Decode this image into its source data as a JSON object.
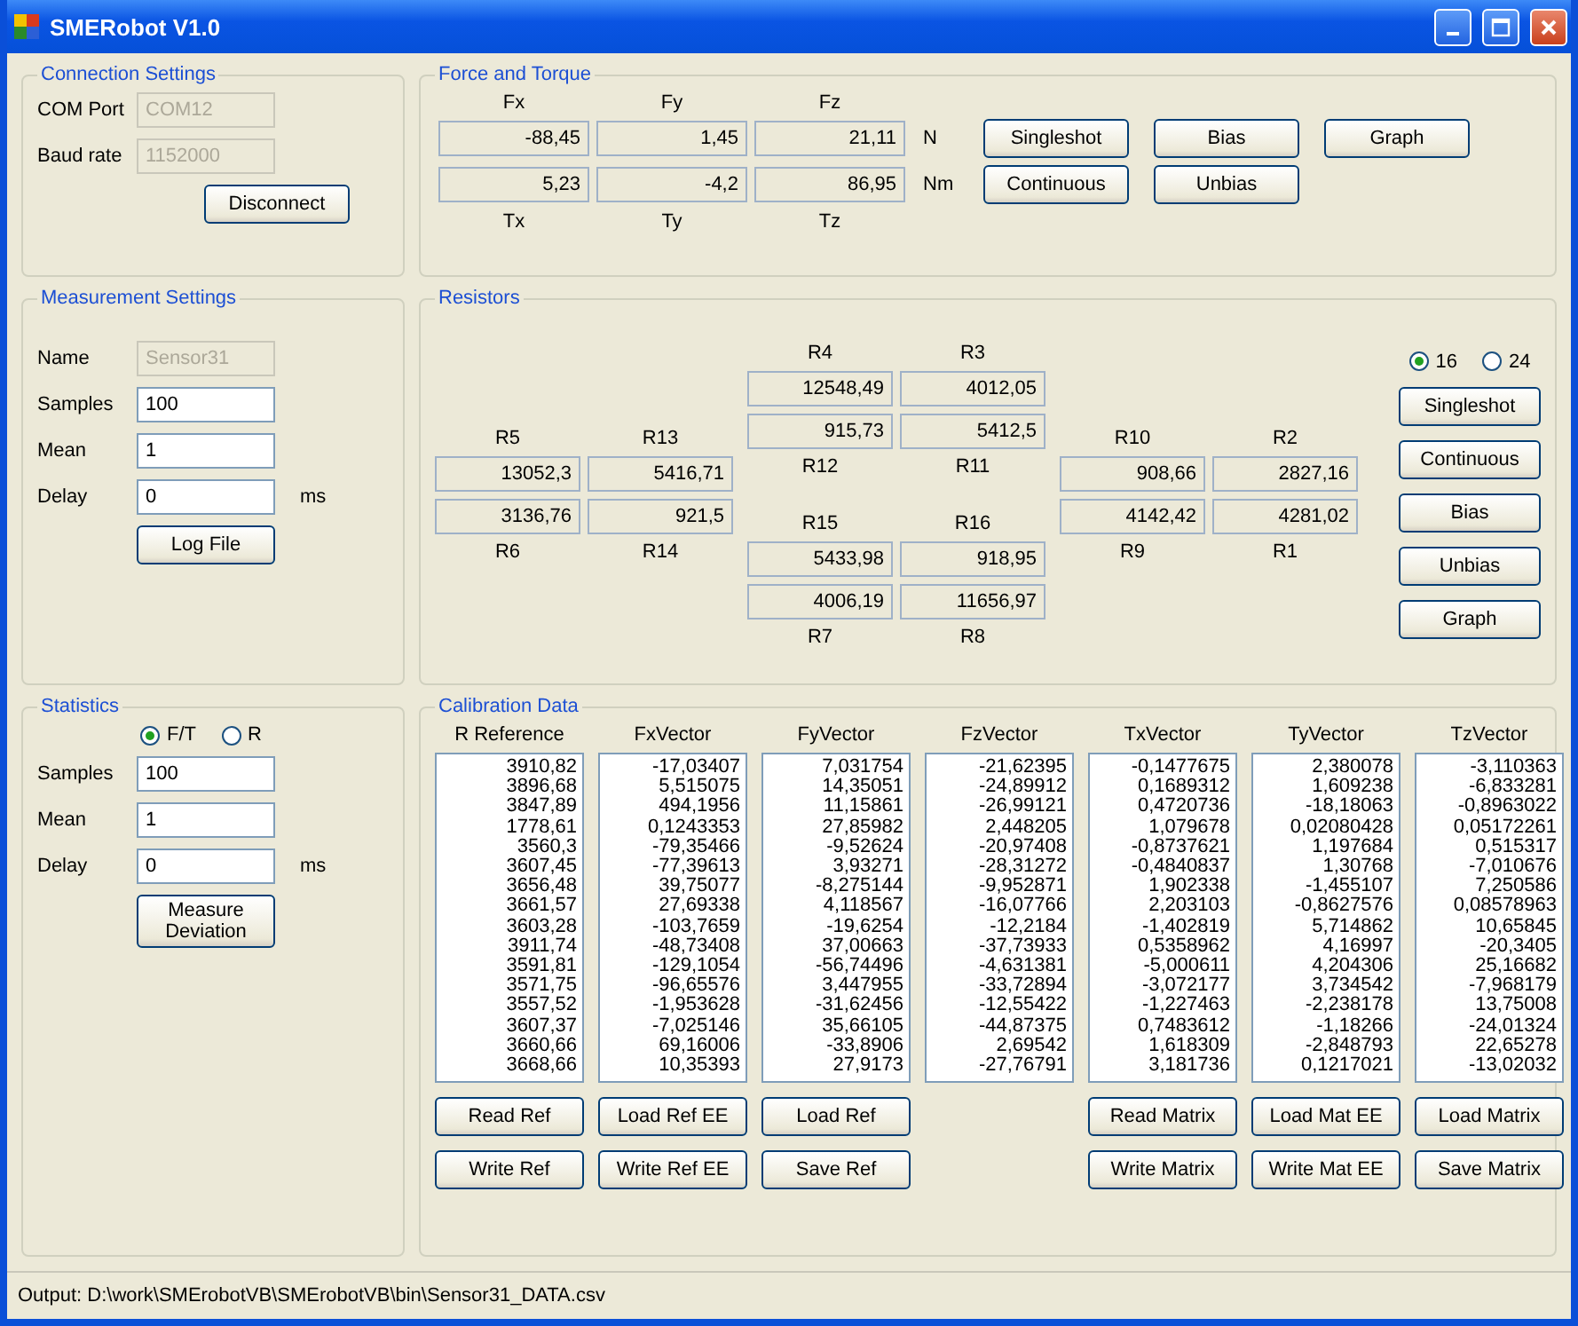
{
  "window": {
    "title": "SMERobot V1.0"
  },
  "connection": {
    "title": "Connection Settings",
    "fields": [
      {
        "label": "COM Port",
        "value": "COM12",
        "disabled": true
      },
      {
        "label": "Baud rate",
        "value": "1152000",
        "disabled": true
      }
    ],
    "button": "Disconnect"
  },
  "force_torque": {
    "title": "Force and Torque",
    "top_labels": [
      "Fx",
      "Fy",
      "Fz"
    ],
    "rows": [
      {
        "values": [
          "-88,45",
          "1,45",
          "21,11"
        ],
        "unit": "N",
        "buttons": [
          "Singleshot",
          "Bias",
          "Graph"
        ]
      },
      {
        "values": [
          "5,23",
          "-4,2",
          "86,95"
        ],
        "unit": "Nm",
        "buttons": [
          "Continuous",
          "Unbias"
        ]
      }
    ],
    "bottom_labels": [
      "Tx",
      "Ty",
      "Tz"
    ]
  },
  "measurement": {
    "title": "Measurement Settings",
    "fields": [
      {
        "label": "Name",
        "value": "Sensor31",
        "disabled": true
      },
      {
        "label": "Samples",
        "value": "100",
        "disabled": false
      },
      {
        "label": "Mean",
        "value": "1",
        "disabled": false
      },
      {
        "label": "Delay",
        "value": "0",
        "disabled": false,
        "unit": "ms"
      }
    ],
    "button": "Log File"
  },
  "resistors": {
    "title": "Resistors",
    "blocks": [
      {
        "rows": [
          {
            "kind": "label",
            "texts": [
              "R5",
              "R13"
            ]
          },
          {
            "kind": "value",
            "texts": [
              "13052,3",
              "5416,71"
            ]
          },
          {
            "kind": "value",
            "texts": [
              "3136,76",
              "921,5"
            ]
          },
          {
            "kind": "label",
            "texts": [
              "R6",
              "R14"
            ]
          }
        ]
      },
      {
        "rows": [
          {
            "kind": "label",
            "texts": [
              "R4",
              "R3"
            ]
          },
          {
            "kind": "value",
            "texts": [
              "12548,49",
              "4012,05"
            ]
          },
          {
            "kind": "value",
            "texts": [
              "915,73",
              "5412,5"
            ]
          },
          {
            "kind": "label",
            "texts": [
              "R12",
              "R11"
            ]
          },
          {
            "kind": "label",
            "texts": [
              "R15",
              "R16"
            ]
          },
          {
            "kind": "value",
            "texts": [
              "5433,98",
              "918,95"
            ]
          },
          {
            "kind": "value",
            "texts": [
              "4006,19",
              "11656,97"
            ]
          },
          {
            "kind": "label",
            "texts": [
              "R7",
              "R8"
            ]
          }
        ]
      },
      {
        "rows": [
          {
            "kind": "label",
            "texts": [
              "R10",
              "R2"
            ]
          },
          {
            "kind": "value",
            "texts": [
              "908,66",
              "2827,16"
            ]
          },
          {
            "kind": "value",
            "texts": [
              "4142,42",
              "4281,02"
            ]
          },
          {
            "kind": "label",
            "texts": [
              "R9",
              "R1"
            ]
          }
        ]
      }
    ],
    "radios": [
      {
        "label": "16",
        "selected": true
      },
      {
        "label": "24",
        "selected": false
      }
    ],
    "buttons": [
      "Singleshot",
      "Continuous",
      "Bias",
      "Unbias",
      "Graph"
    ]
  },
  "statistics": {
    "title": "Statistics",
    "radios": [
      {
        "label": "F/T",
        "selected": true
      },
      {
        "label": "R",
        "selected": false
      }
    ],
    "fields": [
      {
        "label": "Samples",
        "value": "100",
        "disabled": false
      },
      {
        "label": "Mean",
        "value": "1",
        "disabled": false
      },
      {
        "label": "Delay",
        "value": "0",
        "disabled": false,
        "unit": "ms"
      }
    ],
    "button": "Measure Deviation"
  },
  "calibration": {
    "title": "Calibration Data",
    "columns": [
      {
        "header": "R Reference",
        "values": [
          "3910,82",
          "3896,68",
          "3847,89",
          "1778,61",
          "3560,3",
          "3607,45",
          "3656,48",
          "3661,57",
          "3603,28",
          "3911,74",
          "3591,81",
          "3571,75",
          "3557,52",
          "3607,37",
          "3660,66",
          "3668,66"
        ],
        "buttons": [
          "Read Ref",
          "Write Ref"
        ]
      },
      {
        "header": "FxVector",
        "values": [
          "-17,03407",
          "5,515075",
          "494,1956",
          "0,1243353",
          "-79,35466",
          "-77,39613",
          "39,75077",
          "27,69338",
          "-103,7659",
          "-48,73408",
          "-129,1054",
          "-96,65576",
          "-1,953628",
          "-7,025146",
          "69,16006",
          "10,35393"
        ],
        "buttons": [
          "Load Ref EE",
          "Write Ref EE"
        ]
      },
      {
        "header": "FyVector",
        "values": [
          "7,031754",
          "14,35051",
          "11,15861",
          "27,85982",
          "-9,52624",
          "3,93271",
          "-8,275144",
          "4,118567",
          "-19,6254",
          "37,00663",
          "-56,74496",
          "3,447955",
          "-31,62456",
          "35,66105",
          "-33,8906",
          "27,9173"
        ],
        "buttons": [
          "Load Ref",
          "Save Ref"
        ]
      },
      {
        "header": "FzVector",
        "values": [
          "-21,62395",
          "-24,89912",
          "-26,99121",
          "2,448205",
          "-20,97408",
          "-28,31272",
          "-9,952871",
          "-16,07766",
          "-12,2184",
          "-37,73933",
          "-4,631381",
          "-33,72894",
          "-12,55422",
          "-44,87375",
          "2,69542",
          "-27,76791"
        ]
      },
      {
        "header": "TxVector",
        "values": [
          "-0,1477675",
          "0,1689312",
          "0,4720736",
          "1,079678",
          "-0,8737621",
          "-0,4840837",
          "1,902338",
          "2,203103",
          "-1,402819",
          "0,5358962",
          "-5,000611",
          "-3,072177",
          "-1,227463",
          "0,7483612",
          "1,618309",
          "3,181736"
        ],
        "buttons": [
          "Read Matrix",
          "Write Matrix"
        ]
      },
      {
        "header": "TyVector",
        "values": [
          "2,380078",
          "1,609238",
          "-18,18063",
          "0,02080428",
          "1,197684",
          "1,30768",
          "-1,455107",
          "-0,8627576",
          "5,714862",
          "4,16997",
          "4,204306",
          "3,734542",
          "-2,238178",
          "-1,18266",
          "-2,848793",
          "0,1217021"
        ],
        "buttons": [
          "Load Mat EE",
          "Write Mat EE"
        ]
      },
      {
        "header": "TzVector",
        "values": [
          "-3,110363",
          "-6,833281",
          "-0,8963022",
          "0,05172261",
          "0,515317",
          "-7,010676",
          "7,250586",
          "0,08578963",
          "10,65845",
          "-20,3405",
          "25,16682",
          "-7,968179",
          "13,75008",
          "-24,01324",
          "22,65278",
          "-13,02032"
        ],
        "buttons": [
          "Load Matrix",
          "Save Matrix"
        ]
      }
    ]
  },
  "status_bar": {
    "text": "Output: D:\\work\\SMErobotVB\\SMErobotVB\\bin\\Sensor31_DATA.csv"
  }
}
